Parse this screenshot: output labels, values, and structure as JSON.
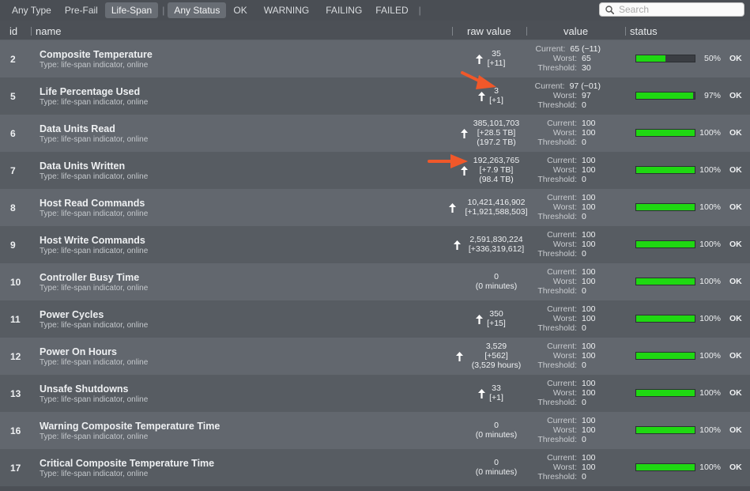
{
  "filters": {
    "type": [
      "Any Type",
      "Pre-Fail",
      "Life-Span"
    ],
    "status": [
      "Any Status",
      "OK",
      "WARNING",
      "FAILING",
      "FAILED"
    ],
    "type_selected": "Life-Span",
    "status_selected": "Any Status"
  },
  "search": {
    "placeholder": "Search",
    "value": ""
  },
  "columns": {
    "id": "id",
    "name": "name",
    "raw": "raw value",
    "value": "value",
    "status": "status"
  },
  "value_labels": {
    "current": "Current:",
    "worst": "Worst:",
    "threshold": "Threshold:"
  },
  "colors": {
    "bar_fill": "#1fd812",
    "annotation_arrow": "#f0582a",
    "row_light": "#62676e",
    "row_dark": "#575c62"
  },
  "rows": [
    {
      "id": "2",
      "name": "Composite Temperature",
      "type": "Type: life-span indicator, online",
      "raw": [
        "35",
        "[+11]"
      ],
      "arrow": true,
      "current": "65  (−11)",
      "worst": "65",
      "threshold": "30",
      "percent": "50%",
      "fill": 0.5,
      "status": "OK"
    },
    {
      "id": "5",
      "name": "Life Percentage Used",
      "type": "Type: life-span indicator, online",
      "raw": [
        "3",
        "[+1]"
      ],
      "arrow": true,
      "current": "97  (−01)",
      "worst": "97",
      "threshold": "0",
      "percent": "97%",
      "fill": 0.97,
      "status": "OK"
    },
    {
      "id": "6",
      "name": "Data Units Read",
      "type": "Type: life-span indicator, online",
      "raw": [
        "385,101,703",
        "[+28.5 TB]",
        "(197.2 TB)"
      ],
      "arrow": true,
      "current": "100",
      "worst": "100",
      "threshold": "0",
      "percent": "100%",
      "fill": 1,
      "status": "OK"
    },
    {
      "id": "7",
      "name": "Data Units Written",
      "type": "Type: life-span indicator, online",
      "raw": [
        "192,263,765",
        "[+7.9 TB]",
        "(98.4 TB)"
      ],
      "arrow": true,
      "current": "100",
      "worst": "100",
      "threshold": "0",
      "percent": "100%",
      "fill": 1,
      "status": "OK"
    },
    {
      "id": "8",
      "name": "Host Read Commands",
      "type": "Type: life-span indicator, online",
      "raw": [
        "10,421,416,902",
        "[+1,921,588,503]"
      ],
      "arrow": true,
      "current": "100",
      "worst": "100",
      "threshold": "0",
      "percent": "100%",
      "fill": 1,
      "status": "OK"
    },
    {
      "id": "9",
      "name": "Host Write Commands",
      "type": "Type: life-span indicator, online",
      "raw": [
        "2,591,830,224",
        "[+336,319,612]"
      ],
      "arrow": true,
      "current": "100",
      "worst": "100",
      "threshold": "0",
      "percent": "100%",
      "fill": 1,
      "status": "OK"
    },
    {
      "id": "10",
      "name": "Controller Busy Time",
      "type": "Type: life-span indicator, online",
      "raw": [
        "0",
        "(0 minutes)"
      ],
      "arrow": false,
      "current": "100",
      "worst": "100",
      "threshold": "0",
      "percent": "100%",
      "fill": 1,
      "status": "OK"
    },
    {
      "id": "11",
      "name": "Power Cycles",
      "type": "Type: life-span indicator, online",
      "raw": [
        "350",
        "[+15]"
      ],
      "arrow": true,
      "current": "100",
      "worst": "100",
      "threshold": "0",
      "percent": "100%",
      "fill": 1,
      "status": "OK"
    },
    {
      "id": "12",
      "name": "Power On Hours",
      "type": "Type: life-span indicator, online",
      "raw": [
        "3,529",
        "[+562]",
        "(3,529 hours)"
      ],
      "arrow": true,
      "current": "100",
      "worst": "100",
      "threshold": "0",
      "percent": "100%",
      "fill": 1,
      "status": "OK"
    },
    {
      "id": "13",
      "name": "Unsafe Shutdowns",
      "type": "Type: life-span indicator, online",
      "raw": [
        "33",
        "[+1]"
      ],
      "arrow": true,
      "current": "100",
      "worst": "100",
      "threshold": "0",
      "percent": "100%",
      "fill": 1,
      "status": "OK"
    },
    {
      "id": "16",
      "name": "Warning Composite Temperature Time",
      "type": "Type: life-span indicator, online",
      "raw": [
        "0",
        "(0 minutes)"
      ],
      "arrow": false,
      "current": "100",
      "worst": "100",
      "threshold": "0",
      "percent": "100%",
      "fill": 1,
      "status": "OK"
    },
    {
      "id": "17",
      "name": "Critical Composite Temperature Time",
      "type": "Type: life-span indicator, online",
      "raw": [
        "0",
        "(0 minutes)"
      ],
      "arrow": false,
      "current": "100",
      "worst": "100",
      "threshold": "0",
      "percent": "100%",
      "fill": 1,
      "status": "OK"
    }
  ]
}
